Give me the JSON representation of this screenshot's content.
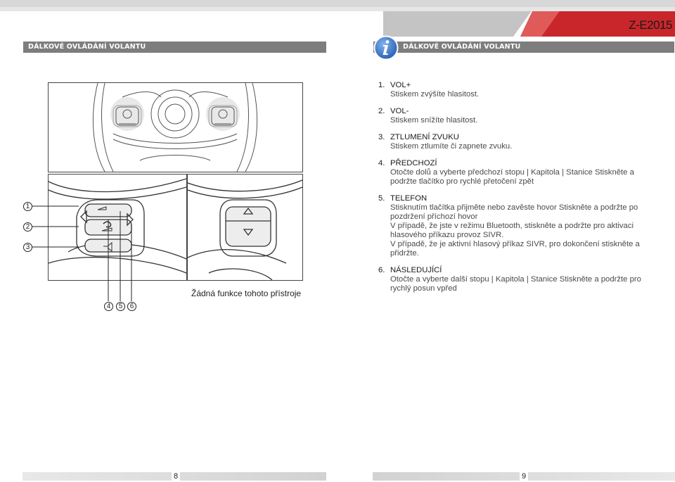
{
  "header": {
    "model": "Z-E2015",
    "left_section": "DÁLKOVÉ OVLÁDÁNÍ VOLANTU",
    "right_section": "DÁLKOVÉ OVLÁDÁNÍ VOLANTU",
    "icon": "info-icon",
    "colors": {
      "band_red": "#c8262b",
      "band_gray": "#bdbdbd",
      "bar": "#7d7d7d",
      "info_blue": "#3a78c9"
    }
  },
  "left_page": {
    "callouts": [
      "1",
      "2",
      "3",
      "4",
      "5",
      "6"
    ],
    "caption": "Žádná funkce tohoto přístroje",
    "page_number": "8"
  },
  "right_page": {
    "items": [
      {
        "num": "1.",
        "title": "VOL+",
        "lines": [
          "Stiskem zvýšíte hlasitost."
        ]
      },
      {
        "num": "2.",
        "title": "VOL-",
        "lines": [
          "Stiskem snížíte hlasitost."
        ]
      },
      {
        "num": "3.",
        "title": "ZTLUMENÍ ZVUKU",
        "lines": [
          "Stiskem ztlumíte či zapnete zvuku."
        ]
      },
      {
        "num": "4.",
        "title": "PŘEDCHOZÍ",
        "lines": [
          "Otočte dolů a vyberte předchozí stopu | Kapitola | Stanice Stiskněte a podržte tlačítko pro rychlé přetočení zpět"
        ]
      },
      {
        "num": "5.",
        "title": "TELEFON",
        "lines": [
          "Stisknutím tlačítka přijměte nebo zavěste hovor Stiskněte a podržte po pozdržení příchozí hovor",
          "V případě, že jste v režimu Bluetooth, stiskněte a podržte pro aktivaci hlasového příkazu provoz SIVR.",
          "V případě, že je aktivní hlasový příkaz SIVR, pro dokončení stiskněte a přidržte."
        ]
      },
      {
        "num": "6.",
        "title": "NÁSLEDUJÍCÍ",
        "lines": [
          "Otočte a vyberte další stopu | Kapitola | Stanice Stiskněte a podržte pro rychlý posun vpřed"
        ]
      }
    ],
    "page_number": "9"
  }
}
